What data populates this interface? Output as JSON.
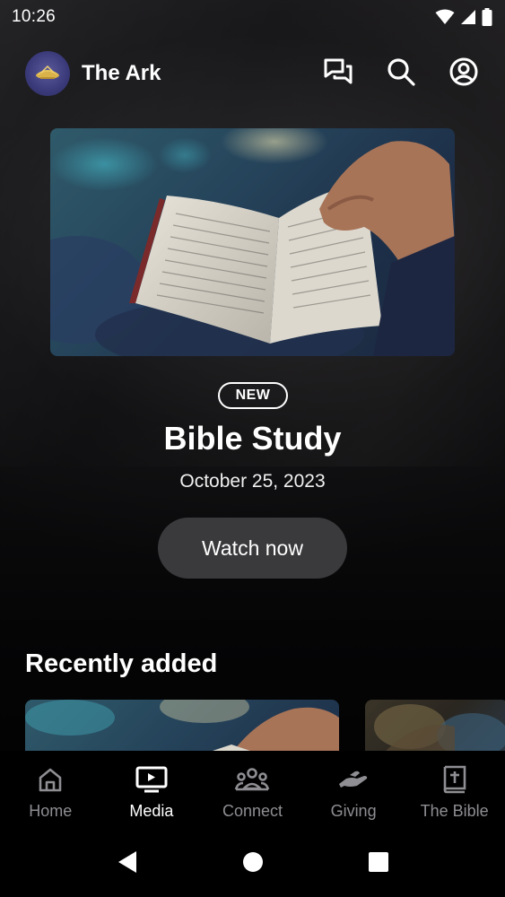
{
  "status_bar": {
    "time": "10:26",
    "icons": [
      "wifi-icon",
      "cellular-signal-icon",
      "battery-icon"
    ]
  },
  "app_bar": {
    "title": "The Ark",
    "actions": [
      "chat-icon",
      "search-icon",
      "account-icon"
    ]
  },
  "hero": {
    "badge": "NEW",
    "title": "Bible Study",
    "date": "October 25, 2023",
    "cta_label": "Watch now"
  },
  "recently_added": {
    "title": "Recently added"
  },
  "bottom_nav": {
    "active": "Media",
    "items": [
      {
        "label": "Home",
        "icon": "home-icon"
      },
      {
        "label": "Media",
        "icon": "tv-play-icon"
      },
      {
        "label": "Connect",
        "icon": "group-icon"
      },
      {
        "label": "Giving",
        "icon": "giving-hand-icon"
      },
      {
        "label": "The Bible",
        "icon": "bible-icon"
      }
    ]
  },
  "system_nav": [
    "back-icon",
    "home-circle-icon",
    "recents-square-icon"
  ],
  "colors": {
    "background": "#000000",
    "button_bg": "#3a393b",
    "inactive_nav": "#8e8e93",
    "active_nav": "#ffffff"
  }
}
